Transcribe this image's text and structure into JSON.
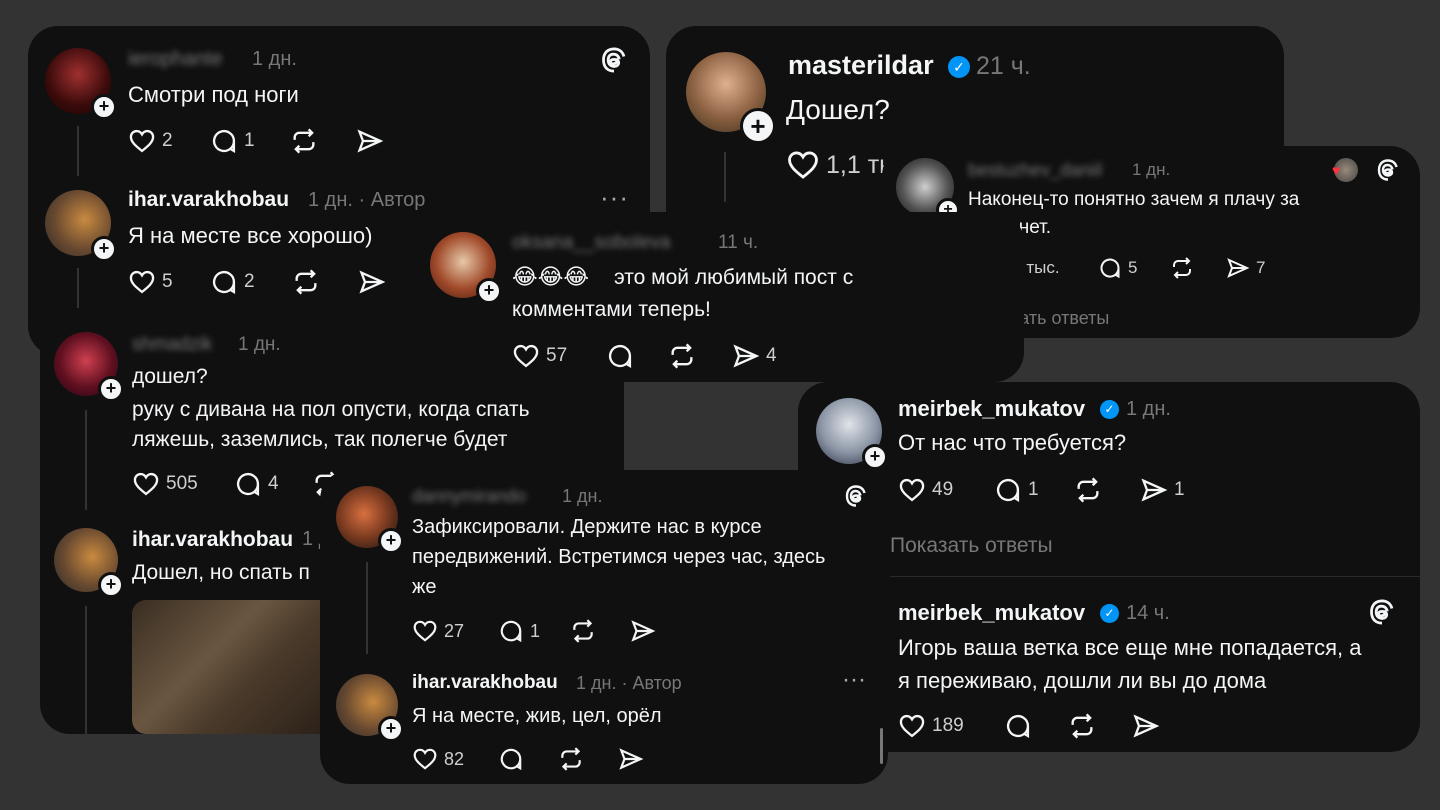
{
  "card1": {
    "c1": {
      "username": "ierophante",
      "time": "1 дн.",
      "text": "Смотри под ноги",
      "likes": "2",
      "comments": "1"
    },
    "c2": {
      "username": "ihar.varakhobau",
      "time": "1 дн. · Автор",
      "text": "Я на месте все хорошо)",
      "likes": "5",
      "comments": "2"
    }
  },
  "card2": {
    "username": "masterildar",
    "time": "21 ч.",
    "text": "Дошел?",
    "likes": "1,1 ты"
  },
  "card3": {
    "username": "bestuzhev_daniil",
    "time": "1 дн.",
    "text1": "Наконец-то понятно зачем я плачу за",
    "text2": "интернет.",
    "likes": "4,2 тыс.",
    "comments": "5",
    "shares": "7",
    "show_replies": "Показать ответы"
  },
  "card4": {
    "username": "oksana__soboleva",
    "time": "11 ч.",
    "emoji": "😂😂😂",
    "text1": "это мой любимый пост с",
    "text2": "комментами теперь!",
    "likes": "57",
    "shares": "4"
  },
  "card5": {
    "c1": {
      "username": "shmadzik",
      "time": "1 дн.",
      "text1": "дошел?",
      "text2": "руку с дивана на пол опусти, когда спать",
      "text3": "ляжешь, заземлись, так полегче будет",
      "likes": "505",
      "comments": "4"
    },
    "c2": {
      "username": "ihar.varakhobau",
      "time": "1 д",
      "text": "Дошел, но спать п"
    }
  },
  "card6": {
    "c1": {
      "username": "meirbek_mukatov",
      "time": "1 дн.",
      "text": "От нас что требуется?",
      "likes": "49",
      "comments": "1",
      "shares": "1"
    },
    "show_replies": "Показать ответы",
    "c2": {
      "username": "meirbek_mukatov",
      "time": "14 ч.",
      "text1": "Игорь ваша ветка все еще мне попадается, а",
      "text2": "я переживаю, дошли ли вы до дома",
      "likes": "189"
    }
  },
  "card7": {
    "c1": {
      "username": "dannymirando",
      "time": "1 дн.",
      "text1": "Зафиксировали. Держите нас в курсе",
      "text2": "передвижений. Встретимся через час, здесь",
      "text3": "же",
      "likes": "27",
      "comments": "1"
    },
    "c2": {
      "username": "ihar.varakhobau",
      "time": "1 дн. · Автор",
      "text": "Я на месте, жив, цел, орёл",
      "likes": "82"
    }
  },
  "icons": [
    "heart-icon",
    "comment-icon",
    "repost-icon",
    "share-icon",
    "threads-logo-icon",
    "verified-icon",
    "more-icon"
  ],
  "colors": {
    "background": "#333333",
    "card": "#101010",
    "text": "#f3f5f7",
    "muted": "#777777",
    "verified": "#0095f6"
  }
}
